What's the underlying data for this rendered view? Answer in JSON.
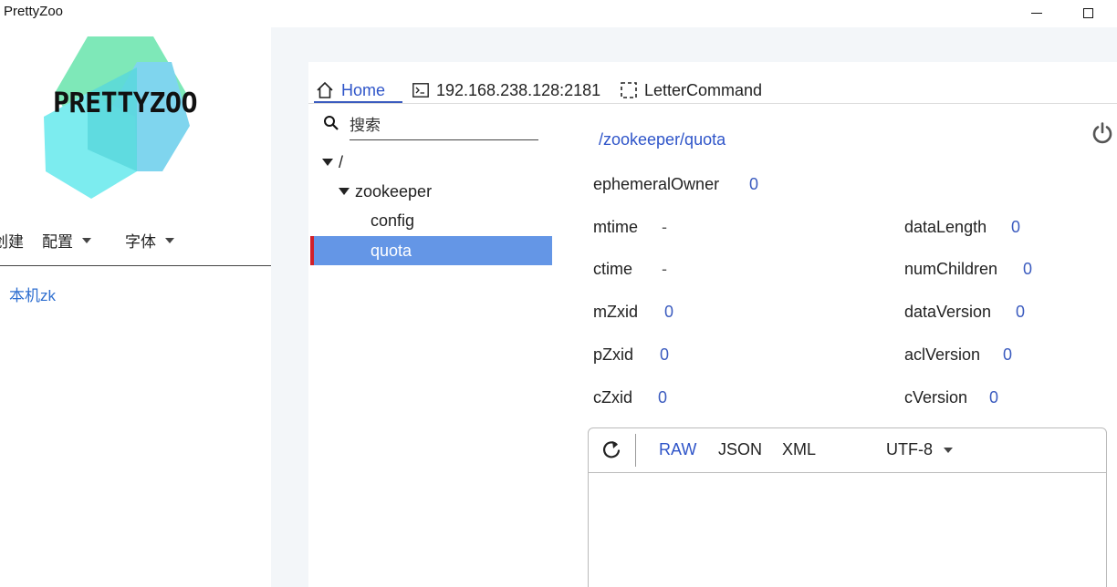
{
  "window": {
    "title": "PrettyZoo"
  },
  "sidebar": {
    "logo_text": "PRETTYZOO",
    "menu": {
      "new": "创建",
      "config": "配置",
      "font": "字体"
    },
    "servers": [
      "本机zk"
    ]
  },
  "tabs": {
    "home": "Home",
    "server": "192.168.238.128:2181",
    "letter_command": "LetterCommand"
  },
  "search": {
    "placeholder": "搜索"
  },
  "tree": {
    "root": "/",
    "zookeeper": "zookeeper",
    "config": "config",
    "quota": "quota"
  },
  "node": {
    "path": "/zookeeper/quota",
    "ephemeralOwner": {
      "label": "ephemeralOwner",
      "value": "0"
    },
    "mtime": {
      "label": "mtime",
      "value": "-"
    },
    "ctime": {
      "label": "ctime",
      "value": "-"
    },
    "mZxid": {
      "label": "mZxid",
      "value": "0"
    },
    "pZxid": {
      "label": "pZxid",
      "value": "0"
    },
    "cZxid": {
      "label": "cZxid",
      "value": "0"
    },
    "dataLength": {
      "label": "dataLength",
      "value": "0"
    },
    "numChildren": {
      "label": "numChildren",
      "value": "0"
    },
    "dataVersion": {
      "label": "dataVersion",
      "value": "0"
    },
    "aclVersion": {
      "label": "aclVersion",
      "value": "0"
    },
    "cVersion": {
      "label": "cVersion",
      "value": "0"
    }
  },
  "editor": {
    "formats": {
      "raw": "RAW",
      "json": "JSON",
      "xml": "XML"
    },
    "active_format": "RAW",
    "charset": "UTF-8",
    "content": ""
  },
  "colors": {
    "accent": "#2f55c9",
    "selection": "#6496e6",
    "selection_marker": "#d0202a"
  }
}
